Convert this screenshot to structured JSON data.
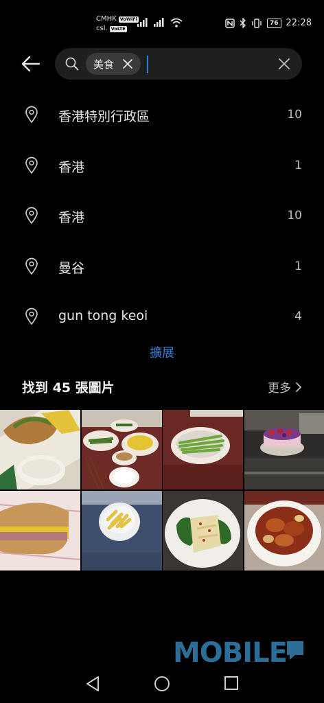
{
  "status": {
    "carrier1": "CMHK",
    "carrier1_badge": "VoWiFi",
    "carrier2": "csl.",
    "carrier2_badge": "VoLTE",
    "battery": "76",
    "time": "22:28"
  },
  "search": {
    "tag": "美食",
    "query": ""
  },
  "locations": [
    {
      "name": "香港特別行政區",
      "count": "10"
    },
    {
      "name": "香港",
      "count": "1"
    },
    {
      "name": "香港",
      "count": "10"
    },
    {
      "name": "曼谷",
      "count": "1"
    },
    {
      "name": "gun tong keoi",
      "count": "4"
    }
  ],
  "expand_label": "擴展",
  "results": {
    "title": "找到 45 張圖片",
    "more_label": "更多"
  },
  "photos": [
    {
      "subject": "wrap-and-dip"
    },
    {
      "subject": "table-of-dishes"
    },
    {
      "subject": "vegetable-plate"
    },
    {
      "subject": "berry-cake"
    },
    {
      "subject": "sandwich"
    },
    {
      "subject": "penne-bowl"
    },
    {
      "subject": "tofu-spinach"
    },
    {
      "subject": "braised-chicken"
    }
  ],
  "watermark": "MOBILE",
  "icons": {
    "back": "arrow-left-icon",
    "search": "search-icon",
    "tag_close": "close-icon",
    "clear": "clear-icon",
    "location": "location-pin-icon",
    "more": "chevron-right-icon"
  },
  "colors": {
    "background": "#000000",
    "search_box": "#1f1f1f",
    "accent": "#3b7fd8",
    "watermark": "#2d6e99"
  }
}
